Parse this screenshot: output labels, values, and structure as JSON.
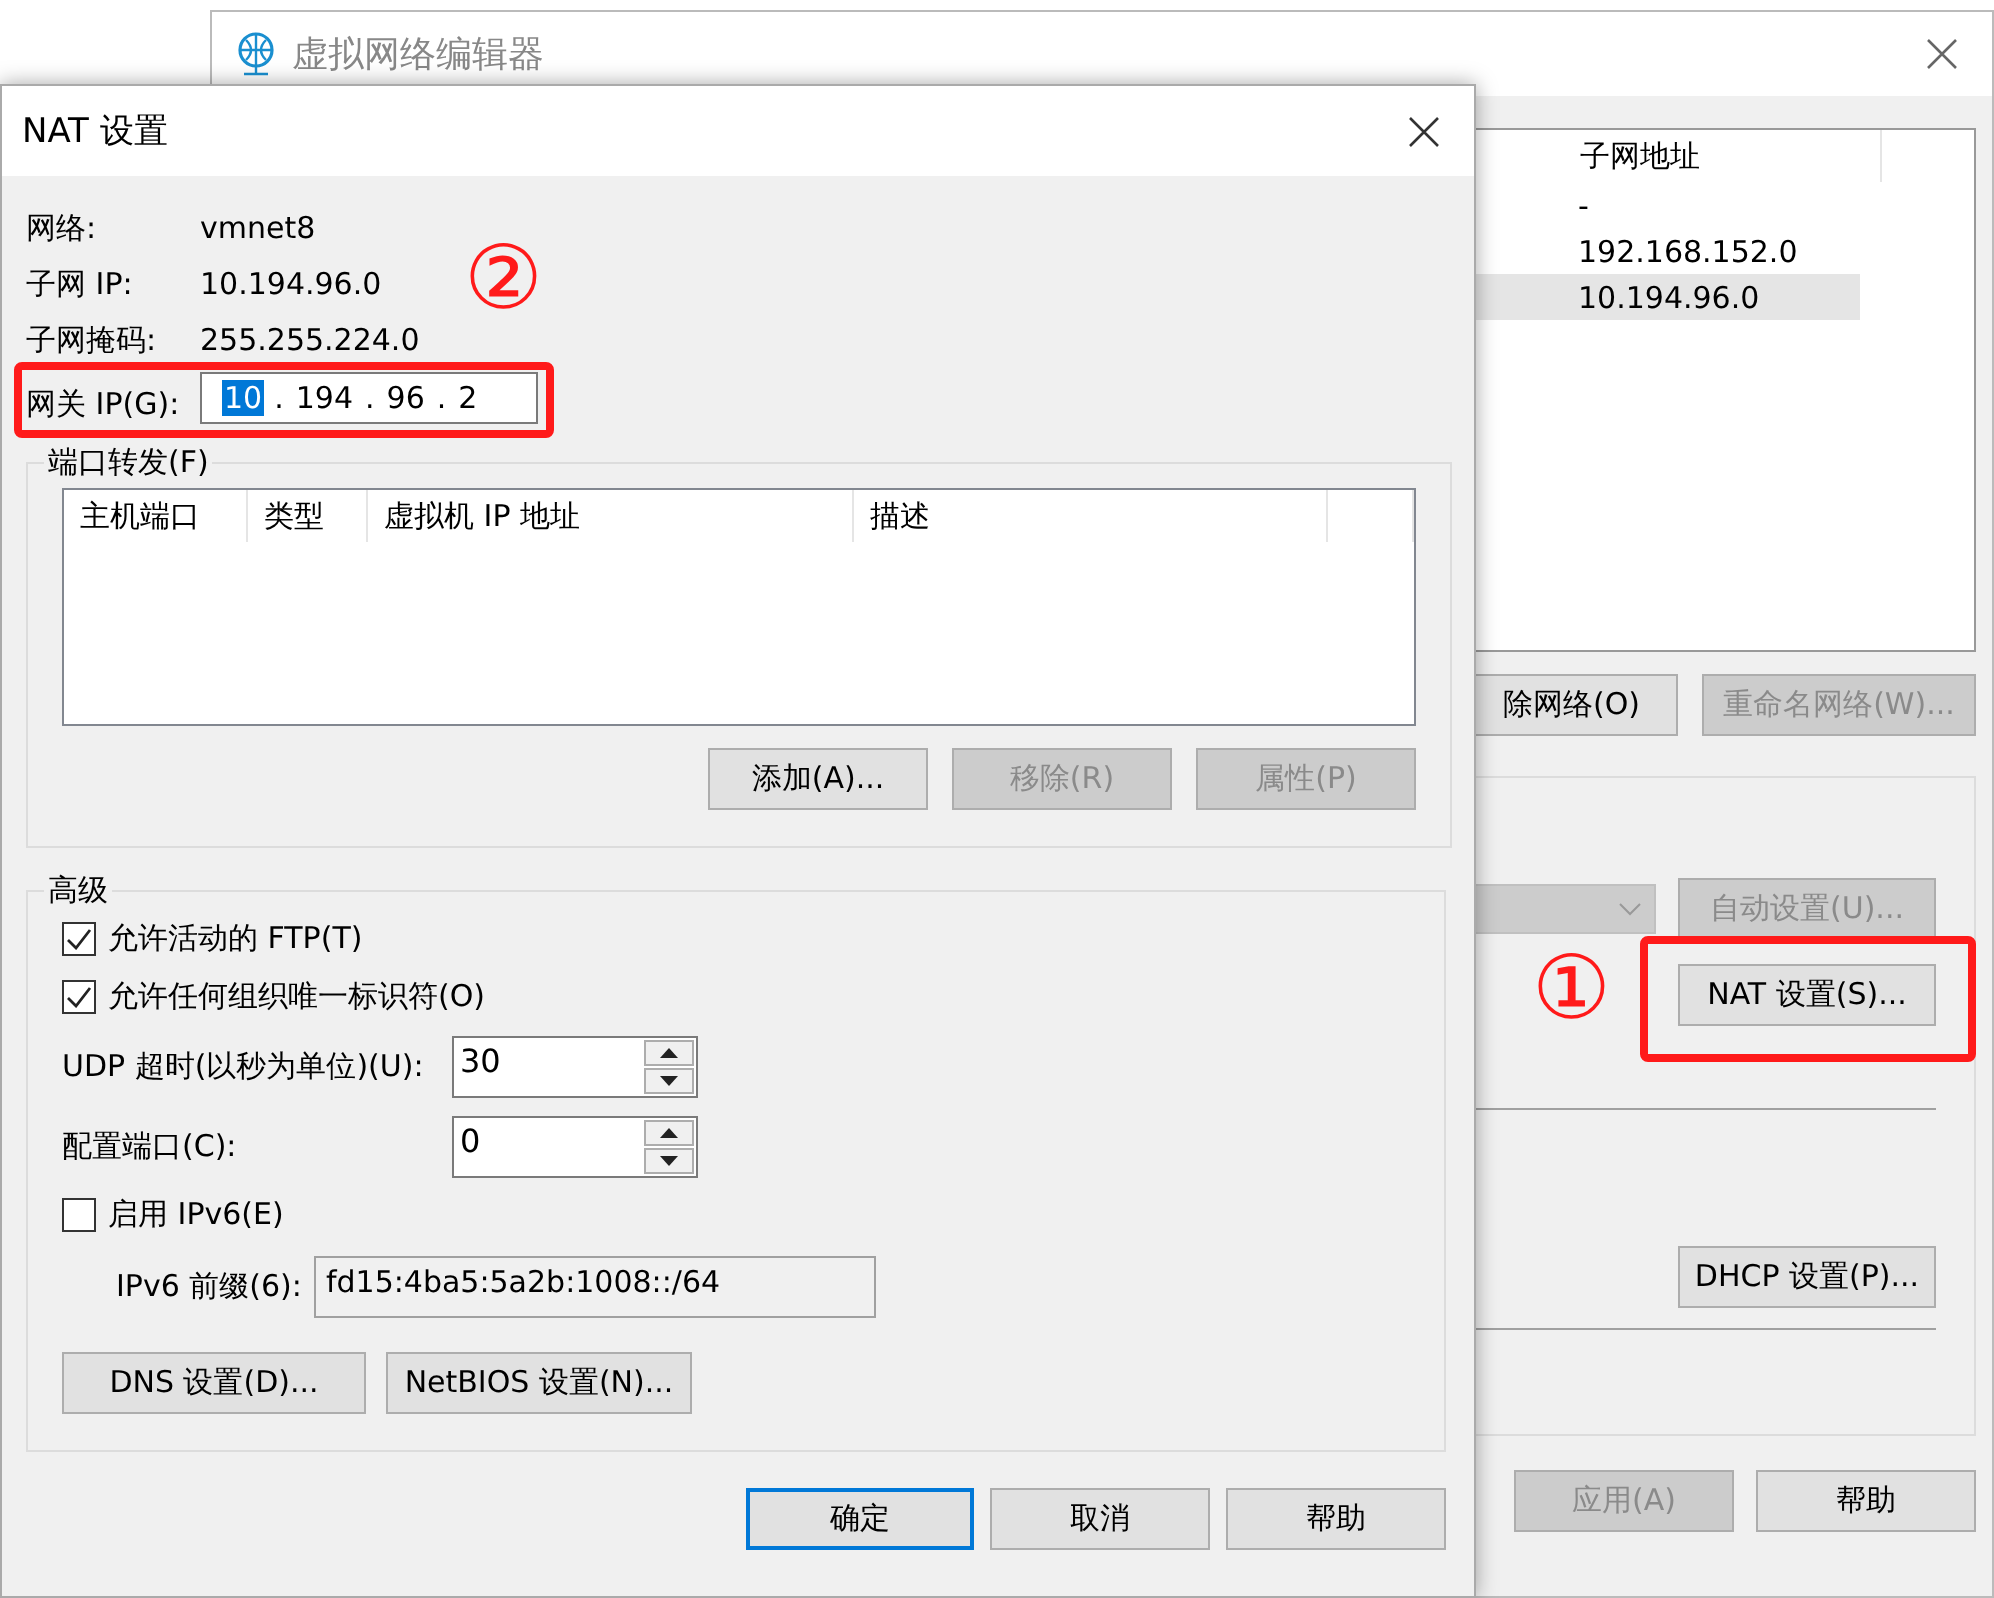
{
  "background_window": {
    "title": "虚拟网络编辑器",
    "network_table": {
      "columns": [
        "子网地址"
      ],
      "rows": [
        {
          "subnet": "-",
          "selected": false
        },
        {
          "subnet": "192.168.152.0",
          "selected": false
        },
        {
          "subnet": "10.194.96.0",
          "selected": true
        }
      ]
    },
    "list_buttons": [
      {
        "label": "除网络(O)",
        "disabled": false
      },
      {
        "label": "重命名网络(W)...",
        "disabled": true
      }
    ],
    "adapter_dropdown": {
      "disabled": true
    },
    "auto_button": {
      "label": "自动设置(U)...",
      "disabled": true
    },
    "nat_button": {
      "label": "NAT 设置(S)...",
      "disabled": false
    },
    "dhcp_button": {
      "label": "DHCP 设置(P)...",
      "disabled": false
    },
    "bottom_buttons": [
      {
        "label": "应用(A)",
        "disabled": true
      },
      {
        "label": "帮助",
        "disabled": false
      }
    ]
  },
  "nat_dialog": {
    "title": "NAT 设置",
    "info": [
      {
        "label": "网络:",
        "value": "vmnet8"
      },
      {
        "label": "子网 IP:",
        "value": "10.194.96.0"
      },
      {
        "label": "子网掩码:",
        "value": "255.255.224.0"
      }
    ],
    "gateway": {
      "label": "网关 IP(G):",
      "separator": ".",
      "octets": [
        {
          "text": "10",
          "selected": true
        },
        {
          "text": "194",
          "selected": false
        },
        {
          "text": "96",
          "selected": false
        },
        {
          "text": "2",
          "selected": false
        }
      ]
    },
    "port_forwarding": {
      "title": "端口转发(F)",
      "columns": [
        "主机端口",
        "类型",
        "虚拟机 IP 地址",
        "描述"
      ],
      "buttons": [
        {
          "label": "添加(A)...",
          "disabled": false
        },
        {
          "label": "移除(R)",
          "disabled": true
        },
        {
          "label": "属性(P)",
          "disabled": true
        }
      ]
    },
    "advanced": {
      "title": "高级",
      "checks": [
        {
          "label": "允许活动的 FTP(T)",
          "checked": true
        },
        {
          "label": "允许任何组织唯一标识符(O)",
          "checked": true
        }
      ],
      "spinners": [
        {
          "label": "UDP 超时(以秒为单位)(U):",
          "value": "30"
        },
        {
          "label": "配置端口(C):",
          "value": "0"
        }
      ],
      "ipv6": {
        "label": "启用 IPv6(E)",
        "checked": false
      },
      "prefix": {
        "label": "IPv6 前缀(6):",
        "value": "fd15:4ba5:5a2b:1008::/64",
        "disabled": true
      },
      "buttons": [
        {
          "label": "DNS 设置(D)..."
        },
        {
          "label": "NetBIOS 设置(N)..."
        }
      ]
    },
    "buttons": [
      {
        "label": "确定",
        "default": true
      },
      {
        "label": "取消",
        "default": false
      },
      {
        "label": "帮助",
        "default": false
      }
    ]
  },
  "annotations": [
    {
      "text": "①"
    },
    {
      "text": "②"
    }
  ]
}
